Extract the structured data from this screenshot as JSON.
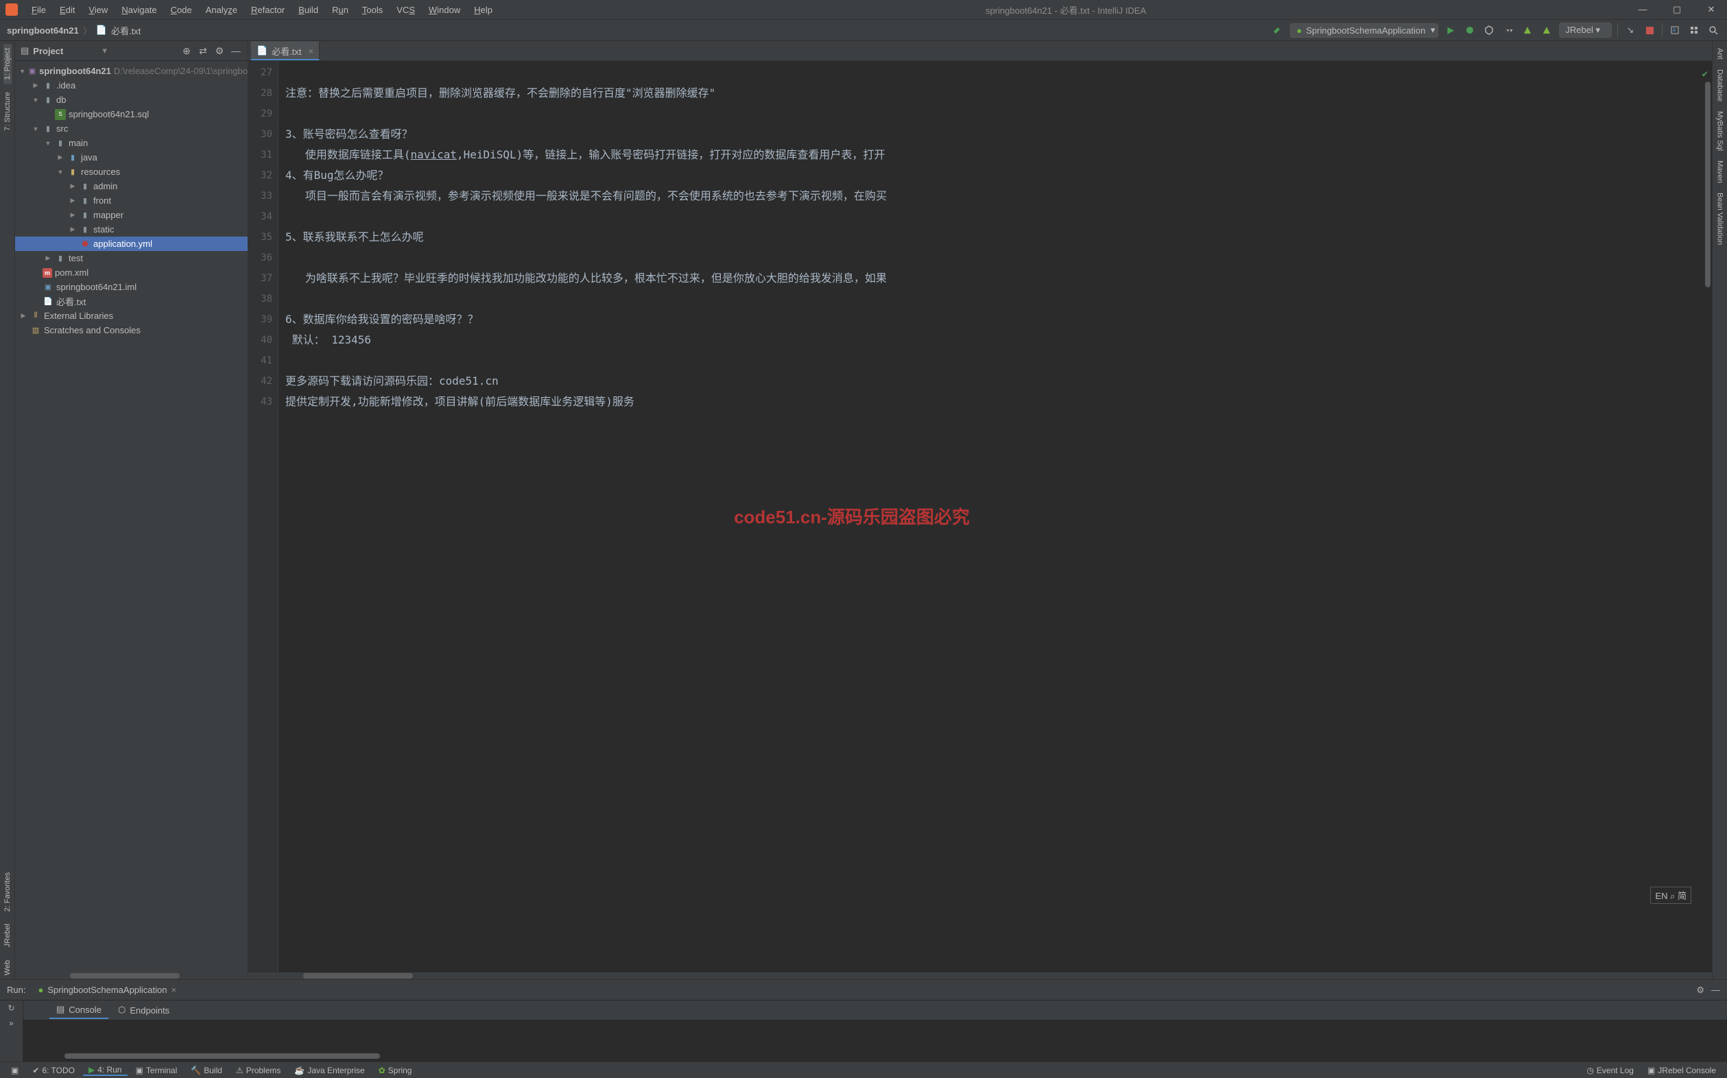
{
  "window": {
    "title": "springboot64n21 - 必看.txt - IntelliJ IDEA"
  },
  "menu": {
    "file": "File",
    "edit": "Edit",
    "view": "View",
    "navigate": "Navigate",
    "code": "Code",
    "analyze": "Analyze",
    "refactor": "Refactor",
    "build": "Build",
    "run": "Run",
    "tools": "Tools",
    "vcs": "VCS",
    "window": "Window",
    "help": "Help"
  },
  "breadcrumb": {
    "project": "springboot64n21",
    "file": "必看.txt"
  },
  "runConfig": {
    "name": "SpringbootSchemaApplication"
  },
  "jrebel": "JRebel",
  "projectPanel": {
    "title": "Project",
    "tree": {
      "root": "springboot64n21",
      "rootPath": "D:\\releaseComp\\24-09\\1\\springbo",
      "idea": ".idea",
      "db": "db",
      "dbSql": "springboot64n21.sql",
      "src": "src",
      "main": "main",
      "java": "java",
      "resources": "resources",
      "admin": "admin",
      "front": "front",
      "mapper": "mapper",
      "static": "static",
      "appYml": "application.yml",
      "test": "test",
      "pom": "pom.xml",
      "iml": "springboot64n21.iml",
      "readme": "必看.txt",
      "extLib": "External Libraries",
      "scratches": "Scratches and Consoles"
    }
  },
  "leftStripe": {
    "project": "1: Project",
    "structure": "7: Structure",
    "favorites": "2: Favorites",
    "jrebel": "JRebel",
    "web": "Web"
  },
  "rightStripe": {
    "ant": "Ant",
    "database": "Database",
    "mybatis": "MyBatis Sql",
    "maven": "Maven",
    "bean": "Bean Validation"
  },
  "editor": {
    "tab": "必看.txt",
    "gutterStart": 27,
    "gutterEnd": 43,
    "lines": {
      "l27": "注意：替换之后需要重启项目，删除浏览器缓存，不会删除的自行百度\"浏览器删除缓存\"",
      "l28": "",
      "l29": "3、账号密码怎么查看呀？",
      "l30_a": "   使用数据库链接工具(",
      "l30_b": "navicat",
      "l30_c": ",HeiDiSQL)等，链接上，输入账号密码打开链接，打开对应的数据库查看用户表，打开",
      "l31": "4、有Bug怎么办呢？",
      "l32": "   项目一般而言会有演示视频，参考演示视频使用一般来说是不会有问题的，不会使用系统的也去参考下演示视频，在购买",
      "l33": "",
      "l34": "5、联系我联系不上怎么办呢",
      "l35": "",
      "l36": "   为啥联系不上我呢？毕业旺季的时候找我加功能改功能的人比较多，根本忙不过来，但是你放心大胆的给我发消息，如果",
      "l37": "",
      "l38": "6、数据库你给我设置的密码是啥呀？？",
      "l39": " 默认： 123456",
      "l40": "",
      "l41": "更多源码下载请访问源码乐园：code51.cn",
      "l42": "提供定制开发,功能新增修改，项目讲解(前后端数据库业务逻辑等)服务",
      "l43": ""
    },
    "watermark": "code51.cn-源码乐园盗图必究",
    "langIndicator": "EN ⌕ 简"
  },
  "runPanel": {
    "label": "Run:",
    "tab": "SpringbootSchemaApplication",
    "console": "Console",
    "endpoints": "Endpoints"
  },
  "statusBar": {
    "todo": "6: TODO",
    "run": "4: Run",
    "terminal": "Terminal",
    "build": "Build",
    "problems": "Problems",
    "javaEE": "Java Enterprise",
    "spring": "Spring",
    "eventLog": "Event Log",
    "jrebelConsole": "JRebel Console"
  }
}
